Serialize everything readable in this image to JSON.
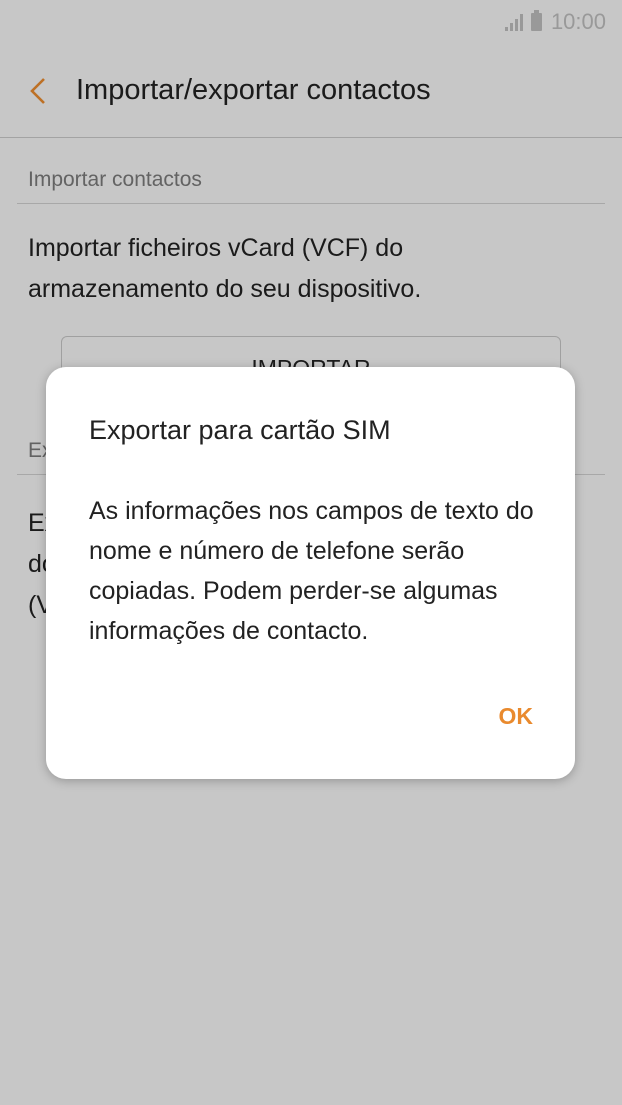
{
  "status_bar": {
    "time": "10:00"
  },
  "app_bar": {
    "title": "Importar/exportar contactos",
    "accent_color": "#e98a2e"
  },
  "import_section": {
    "header": "Importar contactos",
    "description": "Importar ficheiros vCard (VCF) do armazenamento do seu dispositivo.",
    "button_label": "IMPORTAR"
  },
  "export_section": {
    "header": "Ex",
    "description_fragments": [
      "Ex",
      "do",
      "(V"
    ]
  },
  "dialog": {
    "title": "Exportar para cartão SIM",
    "message": "As informações nos campos de texto do nome e número de telefone serão copiadas. Podem perder-se algumas informações de contacto.",
    "ok_label": "OK"
  }
}
